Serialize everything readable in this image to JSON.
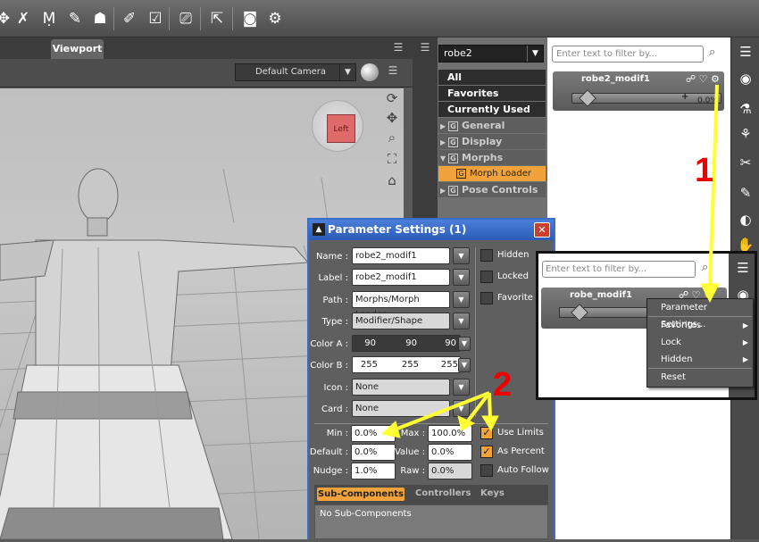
{
  "toolbar": {
    "icons": [
      "move-icon",
      "pose-icon",
      "universal-icon",
      "joint-editor-icon",
      "figure-icon",
      "light-icon",
      "geometry-editor-icon",
      "camera-icon",
      "select-icon",
      "render-icon",
      "render-settings-icon"
    ]
  },
  "viewport": {
    "tab_label": "Viewport",
    "camera_label": "Default Camera",
    "cube_label": "Left"
  },
  "scene_pane": {
    "node_selector": "robe2",
    "groups": [
      {
        "label": "All",
        "style": "dark"
      },
      {
        "label": "Favorites",
        "style": "dark"
      },
      {
        "label": "Currently Used",
        "style": "dark"
      },
      {
        "label": "General",
        "style": "sub"
      },
      {
        "label": "Display",
        "style": "sub"
      },
      {
        "label": "Morphs",
        "style": "sub"
      },
      {
        "label": "Morph Loader",
        "style": "selected"
      },
      {
        "label": "Pose Controls",
        "style": "sub"
      }
    ]
  },
  "parameters_pane": {
    "filter_placeholder": "Enter text to filter by...",
    "property_name": "robe2_modif1",
    "slider_value": "0.0%",
    "slider_fraction": 0.0
  },
  "dialog": {
    "title": "Parameter Settings (1)",
    "name_label": "Name :",
    "name_value": "robe2_modif1",
    "label_label": "Label :",
    "label_value": "robe2_modif1",
    "path_label": "Path :",
    "path_value": "Morphs/Morph Loader",
    "type_label": "Type :",
    "type_value": "Modifier/Shape",
    "color_a_label": "Color A :",
    "color_a_values": [
      "90",
      "90",
      "90"
    ],
    "color_b_label": "Color B :",
    "color_b_values": [
      "255",
      "255",
      "255"
    ],
    "icon_label": "Icon :",
    "icon_value": "None",
    "card_label": "Card :",
    "card_value": "None",
    "hidden_label": "Hidden",
    "locked_label": "Locked",
    "favorite_label": "Favorite",
    "min_label": "Min :",
    "min_value": "0.0%",
    "max_label": "Max :",
    "max_value": "100.0%",
    "default_label": "Default :",
    "default_value": "0.0%",
    "value_label": "Value :",
    "value_value": "0.0%",
    "nudge_label": "Nudge :",
    "nudge_value": "1.0%",
    "raw_label": "Raw :",
    "raw_value": "0.0%",
    "use_limits_label": "Use Limits",
    "as_percent_label": "As Percent",
    "auto_follow_label": "Auto Follow",
    "tabs": [
      "Sub-Components",
      "Controllers",
      "Keys"
    ],
    "sub_text": "No Sub-Components"
  },
  "inset": {
    "filter_placeholder": "Enter text to filter by...",
    "property_name": "robe_modif1",
    "menu": [
      {
        "label": "Parameter Settings...",
        "arrow": ""
      },
      {
        "label": "Favorites",
        "arrow": "▶"
      },
      {
        "label": "Lock",
        "arrow": "▶"
      },
      {
        "label": "Hidden",
        "arrow": "▶"
      },
      {
        "label": "Reset",
        "arrow": ""
      }
    ]
  },
  "annotations": {
    "one": "1",
    "two": "2"
  },
  "colors": {
    "accent": "#f2a23a",
    "dialog_title": "#2c5cb8",
    "annotation": "#ffff33",
    "annotation_number": "#ee0000"
  }
}
